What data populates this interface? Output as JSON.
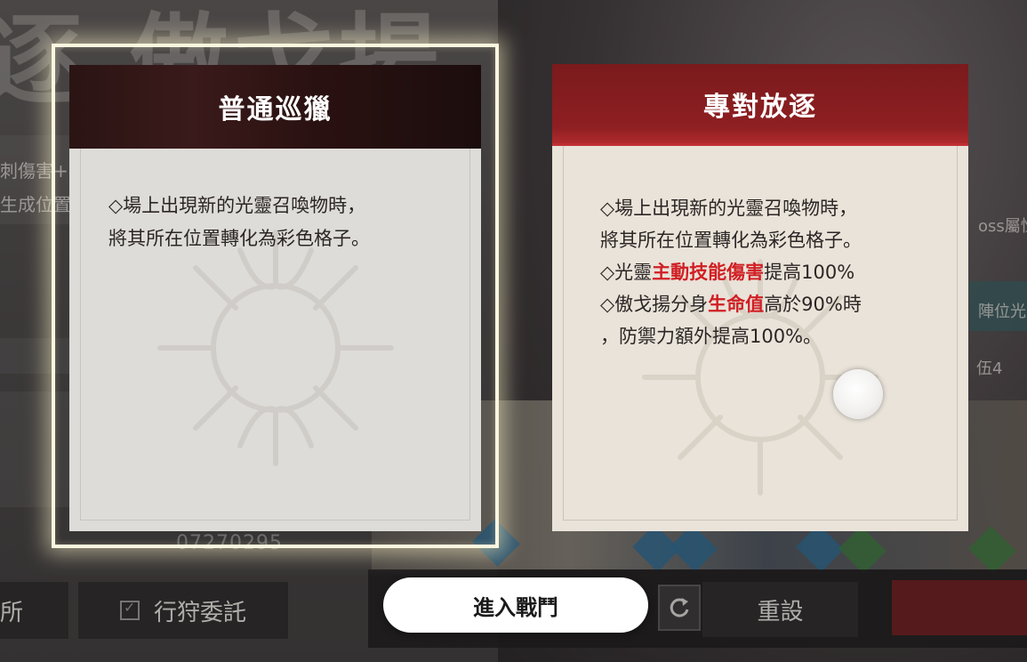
{
  "background": {
    "title": "逐.傲戈揚",
    "side_lines": [
      "刺傷害+",
      "生成位置"
    ],
    "number": "07270295",
    "right_texts": [
      "oss屬性",
      "陣位光量",
      "伍4"
    ]
  },
  "cards": {
    "normal": {
      "title": "普通巡獵",
      "lines": [
        "◇場上出現新的光靈召喚物時，",
        "將其所在位置轉化為彩色格子。"
      ]
    },
    "special": {
      "title": "專對放逐",
      "lines": [
        {
          "plain": "◇場上出現新的光靈召喚物時，"
        },
        {
          "plain": "將其所在位置轉化為彩色格子。"
        },
        {
          "pre": "◇光靈",
          "highlight": "主動技能傷害",
          "post": "提高100%"
        },
        {
          "pre": "◇傲戈揚分身",
          "highlight": "生命值",
          "post": "高於90%時"
        },
        {
          "plain": "，防禦力額外提高100%。"
        }
      ]
    }
  },
  "buttons": {
    "left_cut": "所",
    "hunt": "行狩委託",
    "enter": "進入戰鬥",
    "reset": "重設"
  },
  "icons": {
    "checkbox": "checkbox-icon",
    "refresh": "refresh-icon",
    "emblem": "thorn-emblem-icon"
  },
  "colors": {
    "highlight_red": "#d11f24",
    "special_header": "#8e1f22",
    "card_glow": "#fbf6df"
  }
}
